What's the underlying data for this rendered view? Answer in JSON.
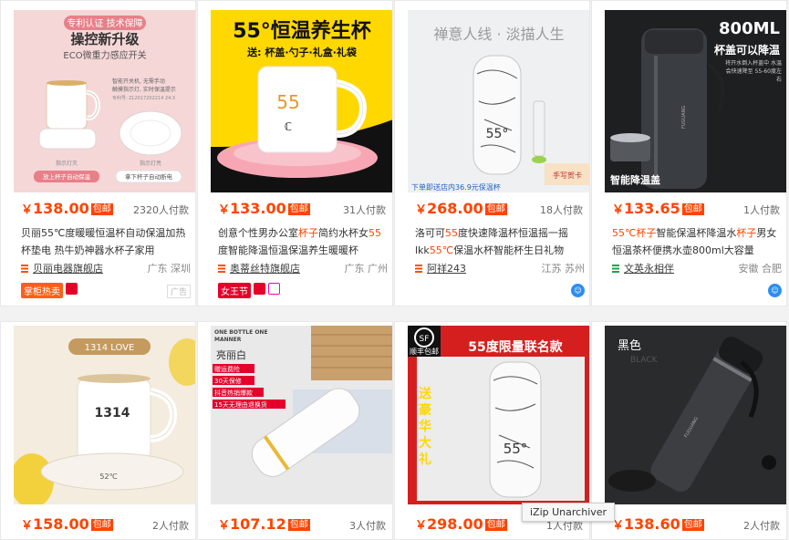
{
  "products": [
    {
      "img_text": {
        "top": "专利认证 技术保障",
        "h1": "操控新升级",
        "h2": "ECO微重力感应开关",
        "btn1": "放上杯子自动保温",
        "btn2": "拿下杯子自动断电",
        "note1": "智能开关机, 无需手动",
        "note2": "触摸指示灯, 实时保温提示",
        "patent": "专利号: ZL2017202214 24.X",
        "l1": "指示灯灭",
        "l2": "指示灯亮"
      },
      "currency": "￥",
      "price": "138.00",
      "free": "包邮",
      "paid": "2320人付款",
      "title_parts": [
        {
          "t": "贝丽55℃度暖暖恒温杯自动保温加热杯垫电 热牛奶神器水杯子家用",
          "hl": false
        }
      ],
      "shop": "贝丽电器旗舰店",
      "location": "广东 深圳",
      "badge": "掌柜热卖",
      "ad": "广告"
    },
    {
      "img_text": {
        "h1": "55°恒温养生杯",
        "h2": "送: 杯盖·勺子·礼盒·礼袋",
        "lcd": "55",
        "mark": "ℂ"
      },
      "currency": "￥",
      "price": "133.00",
      "free": "包邮",
      "paid": "31人付款",
      "title_parts": [
        {
          "t": "创意个性男办公室",
          "hl": false
        },
        {
          "t": "杯子",
          "hl": true
        },
        {
          "t": "简约水杯女",
          "hl": false
        },
        {
          "t": "55",
          "hl": true
        },
        {
          "t": "度智能降温恒温保温养生暖暖杯",
          "hl": false
        }
      ],
      "shop": "奥蒂丝特旗舰店",
      "location": "广东 广州",
      "badge": "女王节"
    },
    {
      "img_text": {
        "top": "禅意人线 · 淡描人生",
        "logo": "55°",
        "bottom": "下单即送店内36.9元保温杯",
        "tag": "手写贺卡"
      },
      "currency": "￥",
      "price": "268.00",
      "free": "包邮",
      "paid": "18人付款",
      "title_parts": [
        {
          "t": "洛可可",
          "hl": false
        },
        {
          "t": "55",
          "hl": true
        },
        {
          "t": "度快速降温杯恒温摇一摇lkk",
          "hl": false
        },
        {
          "t": "55℃",
          "hl": true
        },
        {
          "t": "保温水杯智能杯生日礼物",
          "hl": false
        }
      ],
      "shop": "阿祥243",
      "location": "江苏 苏州"
    },
    {
      "img_text": {
        "h1": "800ML",
        "h2": "杯盖可以降温",
        "note": "将开水倒入杯盖中 水温会快速降至 55-60度左右",
        "bottom": "智能降温盖",
        "brand": "FUGUANG"
      },
      "currency": "￥",
      "price": "133.65",
      "free": "包邮",
      "paid": "1人付款",
      "title_parts": [
        {
          "t": "55℃杯子",
          "hl": true
        },
        {
          "t": "智能保温杯降温水",
          "hl": false
        },
        {
          "t": "杯子",
          "hl": true
        },
        {
          "t": "男女恒温茶杯便携水壶800ml大容量",
          "hl": false
        }
      ],
      "shop": "文英永相伴",
      "location": "安徽 合肥"
    },
    {
      "img_text": {
        "label": "1314 LOVE",
        "cup": "1314",
        "lcd": "52℃"
      },
      "currency": "￥",
      "price": "158.00",
      "free": "包邮",
      "paid": "2人付款"
    },
    {
      "img_text": {
        "top": "ONE BOTTLE ONE MANNER",
        "name": "亮丽白",
        "t1": "赠运费险",
        "t2": "30天保修",
        "t3": "抖音热销爆款",
        "t4": "15天无理由退换货"
      },
      "currency": "￥",
      "price": "107.12",
      "free": "包邮",
      "paid": "3人付款"
    },
    {
      "img_text": {
        "sf": "SF",
        "ship": "顺丰包邮",
        "h1": "55度限量联名款",
        "side": "送豪华大礼",
        "logo": "55°"
      },
      "currency": "￥",
      "price": "298.00",
      "free": "包邮",
      "paid": "1人付款"
    },
    {
      "img_text": {
        "color": "黑色",
        "color_en": "BLACK",
        "brand": "FUGUANG"
      },
      "currency": "￥",
      "price": "138.60",
      "free": "包邮",
      "paid": "2人付款"
    }
  ],
  "tooltip": "iZip Unarchiver",
  "colors": {
    "accent": "#ff4400",
    "shop_icon": "#ff5000",
    "shop_icon_green": "#25a04b"
  }
}
